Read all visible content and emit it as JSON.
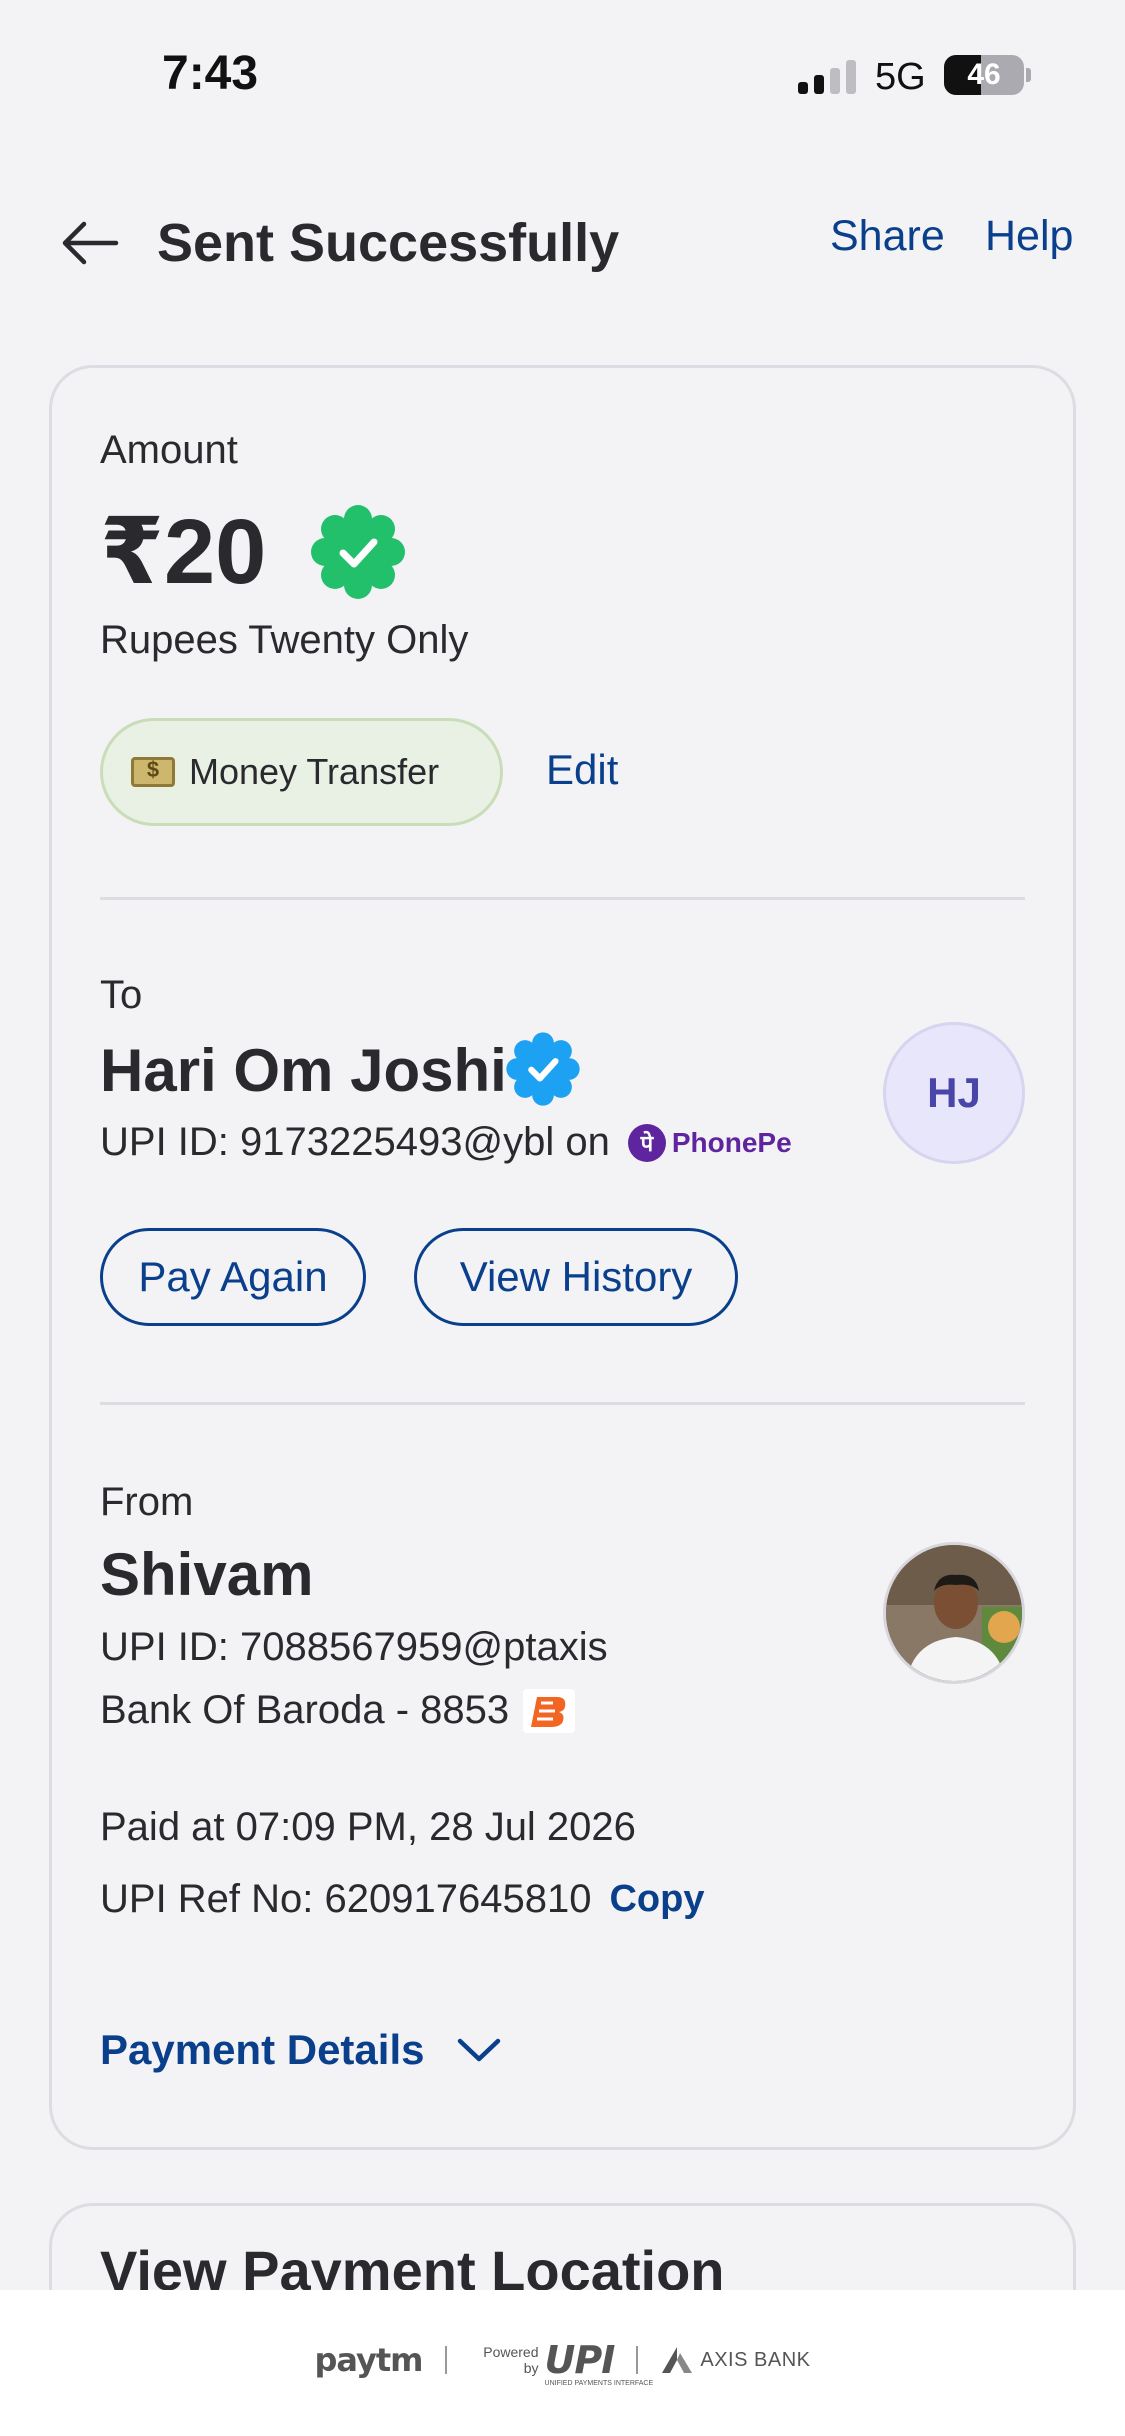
{
  "status_bar": {
    "time": "7:43",
    "network": "5G",
    "battery": "46",
    "battery_level": 0.46
  },
  "header": {
    "title": "Sent Successfully",
    "share_label": "Share",
    "help_label": "Help"
  },
  "amount_section": {
    "label": "Amount",
    "amount": "₹20",
    "amount_words": "Rupees Twenty Only",
    "category_tag": "Money Transfer",
    "edit_label": "Edit"
  },
  "to_section": {
    "label": "To",
    "name": "Hari Om Joshi",
    "upi_text": "UPI ID: 9173225493@ybl on",
    "app_name": "PhonePe",
    "initials": "HJ",
    "pay_again_label": "Pay Again",
    "view_history_label": "View History"
  },
  "from_section": {
    "label": "From",
    "name": "Shivam",
    "upi_text": "UPI ID: 7088567959@ptaxis",
    "bank_text": "Bank Of Baroda - 8853"
  },
  "transaction": {
    "paid_at": "Paid at 07:09 PM, 28 Jul 2026",
    "ref_text": "UPI Ref No: 620917645810",
    "copy_label": "Copy",
    "details_label": "Payment Details"
  },
  "location_card": {
    "title": "View Payment Location"
  },
  "footer": {
    "paytm": "paytm",
    "powered_by": "Powered by",
    "upi": "UPI",
    "upi_sub": "UNIFIED PAYMENTS INTERFACE",
    "bank": "AXIS BANK"
  },
  "colors": {
    "accent": "#0a3f8c",
    "success_green": "#22c06a",
    "verified_blue": "#1da1f2",
    "phonepe_purple": "#5f259f"
  }
}
